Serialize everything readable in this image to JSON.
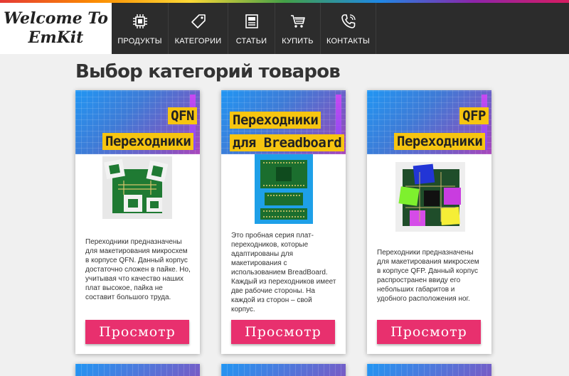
{
  "header": {
    "logo_line1": "Welcome To",
    "logo_line2": "EmKit",
    "nav": [
      {
        "label": "ПРОДУКТЫ",
        "icon": "chip-icon"
      },
      {
        "label": "КАТЕГОРИИ",
        "icon": "tag-icon"
      },
      {
        "label": "СТАТЬИ",
        "icon": "article-icon"
      },
      {
        "label": "КУПИТЬ",
        "icon": "cart-icon"
      },
      {
        "label": "КОНТАКТЫ",
        "icon": "phone-icon"
      }
    ]
  },
  "page_title": "Выбор категорий товаров",
  "cards": [
    {
      "banner_line1": "QFN",
      "banner_line2": "Переходники",
      "description": "Переходники предназначены для макетирования микросхем в корпусе QFN. Данный корпус достаточно сложен в пайке. Но, учитывая что качество наших плат высокое, пайка не составит большого труда.",
      "button": "Просмотр"
    },
    {
      "banner_line1": "Переходники",
      "banner_line2": "для Breadboard",
      "description": "Это пробная серия плат-переходников, которые адаптированы для макетирования с использованием BreadBoard. Каждый из переходников имеет две рабочие стороны. На каждой из сторон – свой корпус.",
      "button": "Просмотр"
    },
    {
      "banner_line1": "QFP",
      "banner_line2": "Переходники",
      "description": "Переходники предназначены для макетирования микросхем в корпусе QFP. Данный корпус распространен ввиду его небольших габаритов и удобного расположения ног.",
      "button": "Просмотр"
    }
  ],
  "colors": {
    "header_bg": "#2c2c2c",
    "button_bg": "#e8306e",
    "banner_label_bg": "#f7c510"
  }
}
